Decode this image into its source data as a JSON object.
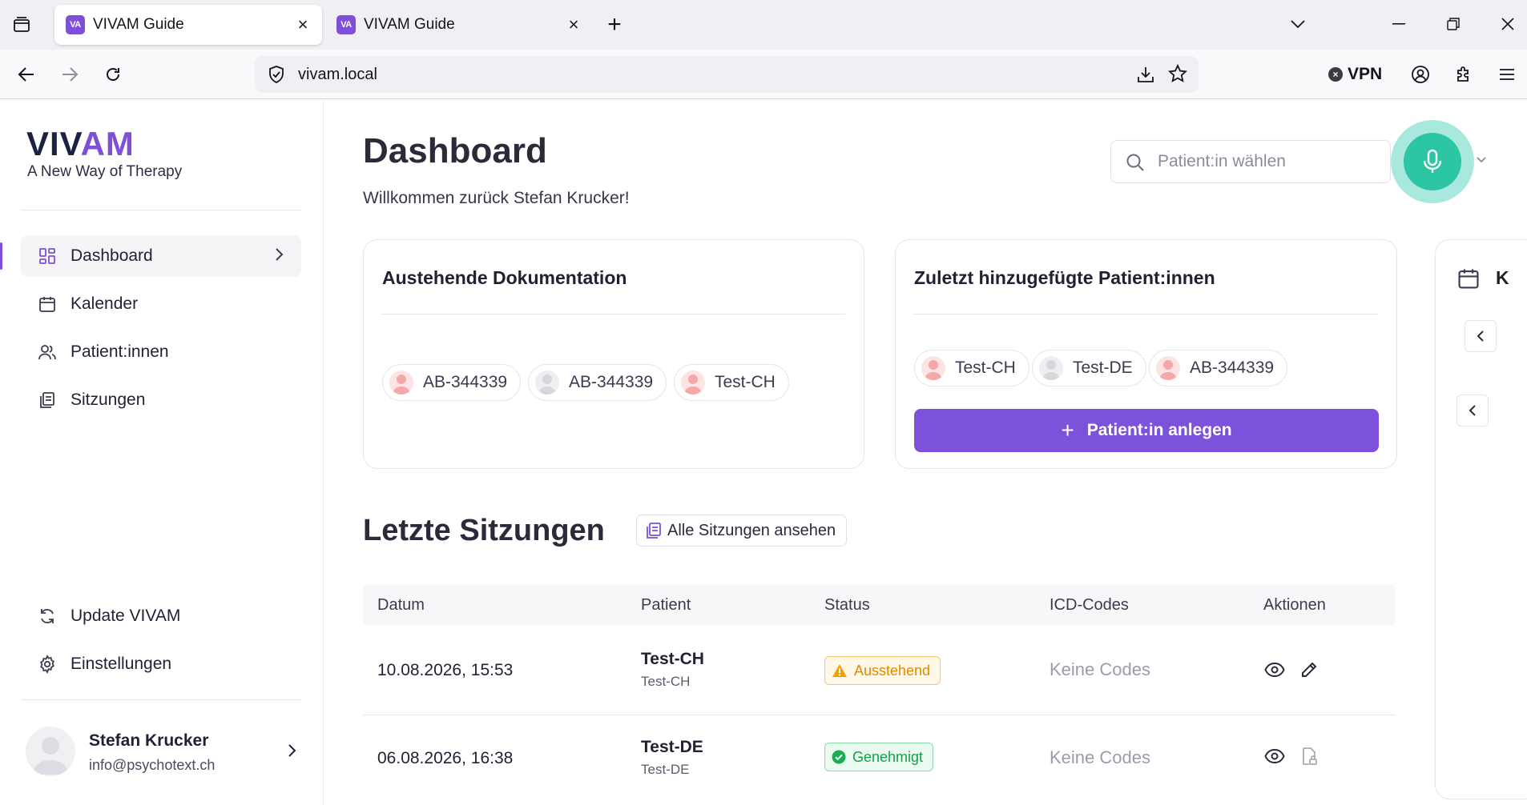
{
  "browser": {
    "tabs": [
      {
        "favicon": "VA",
        "title": "VIVAM Guide",
        "active": true
      },
      {
        "favicon": "VA",
        "title": "VIVAM Guide",
        "active": false
      }
    ],
    "url": "vivam.local",
    "vpn_label": "VPN"
  },
  "sidebar": {
    "logo_a": "VIV",
    "logo_b": "AM",
    "tagline": "A New Way of Therapy",
    "nav": [
      {
        "label": "Dashboard",
        "icon": "dashboard-grid-icon",
        "active": true
      },
      {
        "label": "Kalender",
        "icon": "calendar-icon"
      },
      {
        "label": "Patient:innen",
        "icon": "users-icon"
      },
      {
        "label": "Sitzungen",
        "icon": "documents-icon"
      }
    ],
    "bottom": [
      {
        "label": "Update VIVAM",
        "icon": "refresh-icon"
      },
      {
        "label": "Einstellungen",
        "icon": "gear-icon"
      }
    ],
    "user": {
      "name": "Stefan Krucker",
      "email": "info@psychotext.ch"
    }
  },
  "header": {
    "title": "Dashboard",
    "welcome": "Willkommen zurück Stefan Krucker!",
    "search_placeholder": "Patient:in wählen"
  },
  "cards": {
    "pending": {
      "title": "Austehende Dokumentation",
      "patients": [
        "AB-344339",
        "AB-344339",
        "Test-CH"
      ]
    },
    "recent": {
      "title": "Zuletzt hinzugefügte Patient:innen",
      "patients": [
        "Test-CH",
        "Test-DE",
        "AB-344339"
      ],
      "button": "Patient:in anlegen"
    },
    "calendar_partial_label": "K"
  },
  "sessions": {
    "title": "Letzte Sitzungen",
    "view_all": "Alle Sitzungen ansehen",
    "columns": [
      "Datum",
      "Patient",
      "Status",
      "ICD-Codes",
      "Aktionen"
    ],
    "rows": [
      {
        "date": "10.08.2026, 15:53",
        "patient": "Test-CH",
        "patient_sub": "Test-CH",
        "status": "Ausstehend",
        "icd": "Keine Codes"
      },
      {
        "date": "06.08.2026, 16:38",
        "patient": "Test-DE",
        "patient_sub": "Test-DE",
        "status": "Genehmigt",
        "icd": "Keine Codes"
      }
    ]
  },
  "colors": {
    "brand": "#7e4fd8",
    "mic": "#2cc6a4",
    "pending": "#e08a00",
    "approved": "#14a047"
  }
}
